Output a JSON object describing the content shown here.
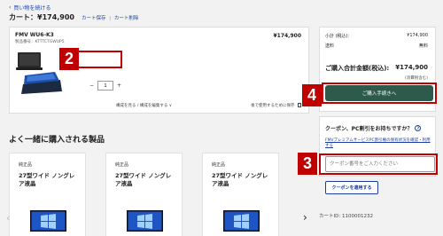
{
  "nav": {
    "back_label": "買い物を続ける"
  },
  "cart": {
    "title": "カート：¥174,900",
    "save_label": "カート保存",
    "separator": "|",
    "delete_label": "カート削除"
  },
  "product": {
    "name": "FMV WU6-K3",
    "code": "製品番号：KTTTCTGWUP5",
    "price": "¥174,900",
    "quantity": "1",
    "minus": "−",
    "plus": "+",
    "view_edit": "構成を見る / 構成を編集する ∨",
    "later": "後で使用するために保存",
    "later_icon": "bookmark-icon"
  },
  "summary": {
    "subtotal_label": "小計 (税込):",
    "subtotal_value": "¥174,900",
    "shipping_label": "送料",
    "shipping_value": "無料",
    "total_label": "ご購入合計金額(税込):",
    "total_value": "¥174,900",
    "tax_note": "(消費税含む)"
  },
  "checkout": {
    "label": "ご購入手続きへ"
  },
  "coupon": {
    "question": "クーポン、PC割引をお持ちですか？",
    "note": "FMVプレミアムサービスPC割引権の保有状況を確認・利用する",
    "placeholder": "クーポン番号をご入力ください",
    "apply_label": "クーポンを適用する"
  },
  "cart_id": "カートID: 1100001232",
  "recommend": {
    "title": "よく一緒に購入される製品",
    "items": [
      {
        "tag": "純正品",
        "name": "27型ワイド ノングレア液晶"
      },
      {
        "tag": "純正品",
        "name": "27型ワイド ノングレア液晶"
      },
      {
        "tag": "純正品",
        "name": "27型ワイド ノングレア液晶"
      }
    ]
  },
  "callouts": {
    "n2": "2",
    "n3": "3",
    "n4": "4"
  },
  "colors": {
    "accent_red": "#c00000",
    "checkout_green": "#2d5a4a",
    "link_blue": "#1a3fa0"
  }
}
